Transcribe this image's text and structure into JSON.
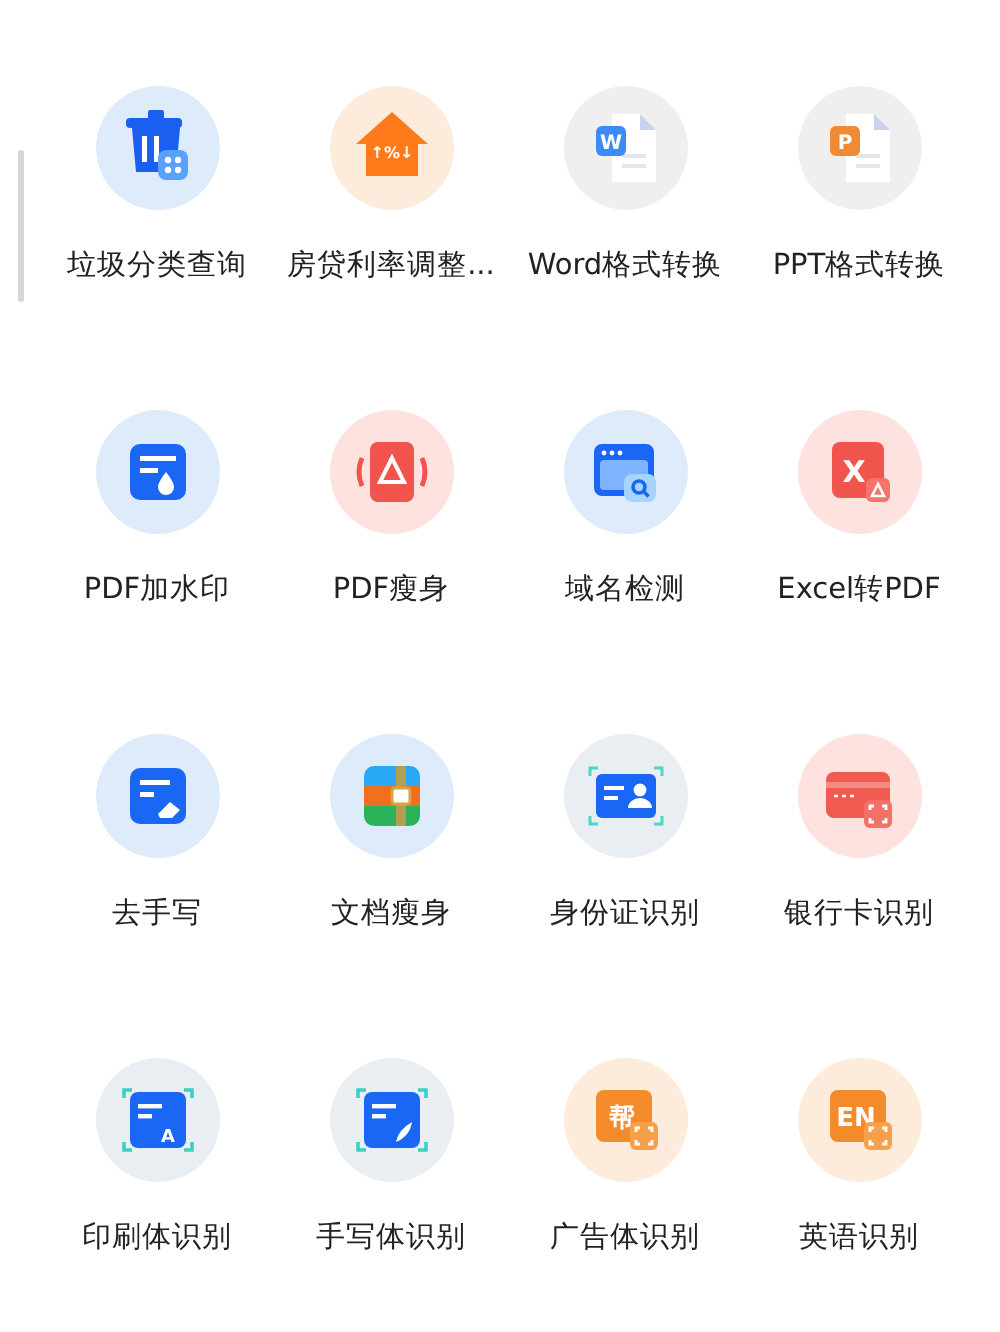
{
  "tools": [
    {
      "label": "垃圾分类查询",
      "kind": "trash"
    },
    {
      "label": "房贷利率调整...",
      "kind": "house",
      "glyph": "↑%↓"
    },
    {
      "label": "Word格式转换",
      "kind": "doc",
      "glyph": "W"
    },
    {
      "label": "PPT格式转换",
      "kind": "doc-orange",
      "glyph": "P"
    },
    {
      "label": "PDF加水印",
      "kind": "watermark"
    },
    {
      "label": "PDF瘦身",
      "kind": "pdf-slim"
    },
    {
      "label": "域名检测",
      "kind": "domain"
    },
    {
      "label": "Excel转PDF",
      "kind": "excel",
      "glyph": "X"
    },
    {
      "label": "去手写",
      "kind": "eraser"
    },
    {
      "label": "文档瘦身",
      "kind": "doc-slim"
    },
    {
      "label": "身份证识别",
      "kind": "id-card"
    },
    {
      "label": "银行卡识别",
      "kind": "bank-card"
    },
    {
      "label": "印刷体识别",
      "kind": "print",
      "glyph": "A"
    },
    {
      "label": "手写体识别",
      "kind": "hand"
    },
    {
      "label": "广告体识别",
      "kind": "ad",
      "glyph": "帮"
    },
    {
      "label": "英语识别",
      "kind": "ad",
      "glyph": "EN"
    }
  ]
}
